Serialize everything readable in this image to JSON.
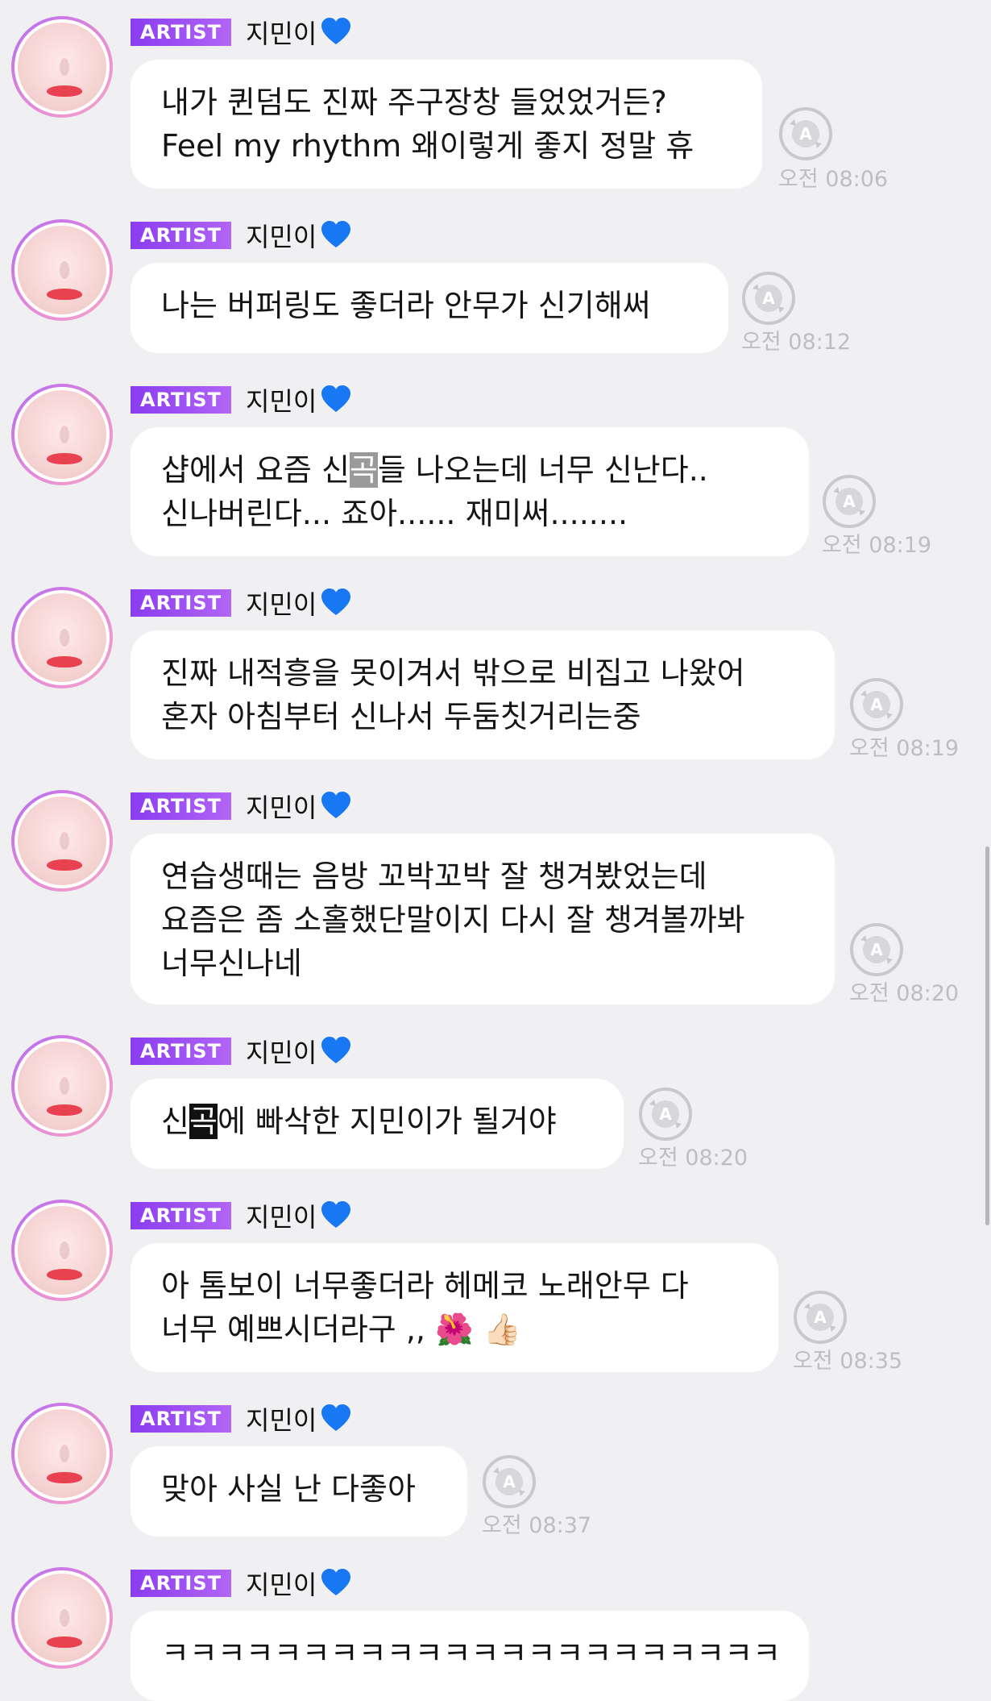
{
  "artist_badge": "ARTIST",
  "sender_name": "지민이",
  "heart_icon": "blue-heart-icon",
  "translate_icon": "translate-a-icon",
  "colors": {
    "background": "#f0f0f3",
    "badge": "#8a3cf0",
    "heart": "#1877f2",
    "time_text": "#bdbdc2"
  },
  "messages": [
    {
      "text": "내가 퀸덤도 진짜 주구장창 들었었거든?\nFeel my rhythm 왜이렇게 좋지 정말 휴",
      "time": "오전 08:06"
    },
    {
      "text": "나는 버퍼링도 좋더라 안무가 신기해써",
      "time": "오전 08:12"
    },
    {
      "text_before": " 샵에서 요즘 신",
      "text_mark": "곡",
      "text_after": "들 나오는데 너무 신난다..\n신나버린다... 죠아...... 재미써........",
      "time": "오전 08:19"
    },
    {
      "text": "진짜 내적흥을 못이겨서 밖으로 비집고 나왔어\n혼자 아침부터 신나서 두둠칫거리는중",
      "time": "오전 08:19"
    },
    {
      "text": "연습생때는 음방 꼬박꼬박 잘 챙겨봤었는데\n요즘은 좀 소홀했단말이지 다시 잘 챙겨볼까봐\n너무신나네",
      "time": "오전 08:20"
    },
    {
      "text_before": "신",
      "text_mark": "곡",
      "text_after": "에 빠삭한 지민이가 될거야",
      "time": "오전 08:20"
    },
    {
      "text": "아 톰보이 너무좋더라 헤메코 노래안무 다\n너무 예쁘시더라구 ,, 🌺 👍🏻",
      "time": "오전 08:35"
    },
    {
      "text": "맞아 사실 난 다좋아",
      "time": "오전 08:37"
    },
    {
      "text": "ㅋㅋㅋㅋㅋㅋㅋㅋㅋㅋㅋㅋㅋㅋㅋㅋㅋㅋㅋㅋㅋㅋ"
    }
  ]
}
